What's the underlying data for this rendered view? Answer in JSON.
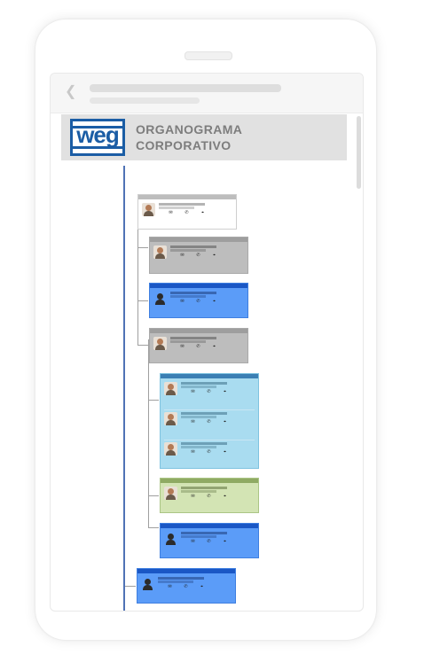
{
  "app": {
    "header_title_line1": "ORGANOGRAMA",
    "header_title_line2": "CORPORATIVO",
    "logo_text": "weg",
    "back_icon": "chevron-left-icon"
  },
  "colors": {
    "brand_blue": "#1b5da5",
    "tree_line": "#4f72b5",
    "card_white_border": "#cfcfcf",
    "card_gray": "#bdbdbd",
    "card_blue": "#5b9cf8",
    "card_light_blue": "#a9dcf0",
    "card_green": "#d3e4b4"
  },
  "card_icons": [
    "email-icon",
    "phone-icon",
    "location-icon"
  ]
}
